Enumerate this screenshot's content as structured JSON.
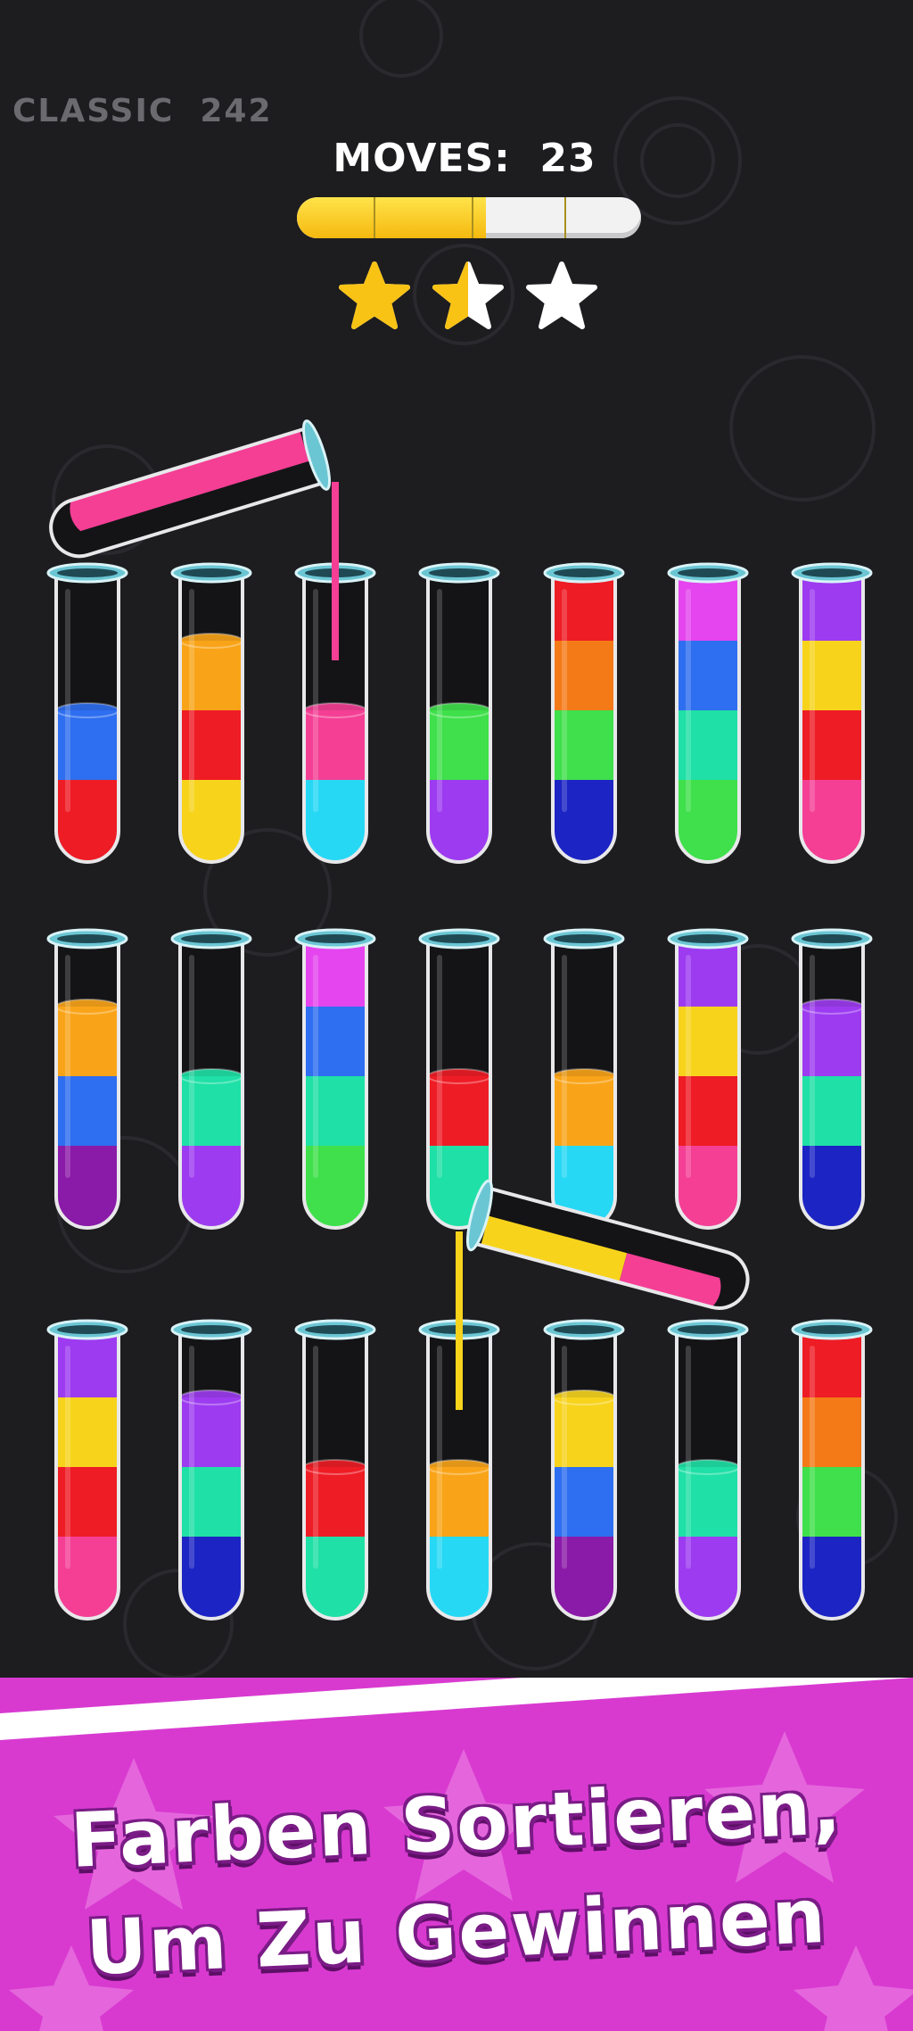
{
  "hud": {
    "level_label": "CLASSIC",
    "level_number": "242",
    "moves_label": "MOVES:",
    "moves_value": "23",
    "progress": 0.55,
    "stars_earned": 1.5,
    "stars_total": 3
  },
  "colors": {
    "red": "#ee1c25",
    "blue": "#2e6ef0",
    "yellow": "#f7d31c",
    "orange": "#f9a418",
    "pink": "#f43f95",
    "cyan": "#27d8f4",
    "green": "#3fe04b",
    "purple": "#9d3bf0",
    "magenta": "#e545ee",
    "teal": "#1fe0a6",
    "navy": "#1c24c4",
    "violet": "#8a1aa8",
    "darkorange": "#f47a18",
    "banner": "#d83ad0"
  },
  "tubes": [
    {
      "id": "r1c1",
      "layers": [
        "red",
        "blue"
      ]
    },
    {
      "id": "r1c2",
      "layers": [
        "yellow",
        "red",
        "orange"
      ]
    },
    {
      "id": "r1c3",
      "layers": [
        "cyan",
        "pink"
      ],
      "receiving": "pink"
    },
    {
      "id": "r1c4",
      "layers": [
        "purple",
        "green"
      ]
    },
    {
      "id": "r1c5",
      "layers": [
        "navy",
        "green",
        "darkorange",
        "red"
      ]
    },
    {
      "id": "r1c6",
      "layers": [
        "green",
        "teal",
        "blue",
        "magenta"
      ]
    },
    {
      "id": "r1c7",
      "layers": [
        "pink",
        "red",
        "yellow",
        "purple"
      ]
    },
    {
      "id": "r2c1",
      "layers": [
        "violet",
        "blue",
        "orange"
      ]
    },
    {
      "id": "r2c2",
      "layers": [
        "purple",
        "teal"
      ]
    },
    {
      "id": "r2c3",
      "layers": [
        "green",
        "teal",
        "blue",
        "magenta"
      ]
    },
    {
      "id": "r2c4",
      "layers": [
        "teal",
        "red"
      ]
    },
    {
      "id": "r2c5",
      "layers": [
        "cyan",
        "orange"
      ]
    },
    {
      "id": "r2c6",
      "layers": [
        "pink",
        "red",
        "yellow",
        "purple"
      ]
    },
    {
      "id": "r2c7",
      "layers": [
        "navy",
        "teal",
        "purple"
      ]
    },
    {
      "id": "r3c1",
      "layers": [
        "pink",
        "red",
        "yellow",
        "purple"
      ]
    },
    {
      "id": "r3c2",
      "layers": [
        "navy",
        "teal",
        "purple"
      ]
    },
    {
      "id": "r3c3",
      "layers": [
        "teal",
        "red"
      ]
    },
    {
      "id": "r3c4",
      "layers": [
        "cyan",
        "orange"
      ],
      "receiving": "orange"
    },
    {
      "id": "r3c5",
      "layers": [
        "violet",
        "blue",
        "yellow"
      ]
    },
    {
      "id": "r3c6",
      "layers": [
        "purple",
        "teal"
      ]
    },
    {
      "id": "r3c7",
      "layers": [
        "navy",
        "green",
        "darkorange",
        "red"
      ]
    }
  ],
  "pouring_tubes": [
    {
      "id": "pour-1",
      "liquid": "pink",
      "target": "r1c3"
    },
    {
      "id": "pour-2",
      "liquid": "yellow",
      "liquid_tail": "pink",
      "target": "r3c4"
    }
  ],
  "banner": {
    "line1": "Farben Sortieren,",
    "line2": "Um Zu Gewinnen"
  }
}
